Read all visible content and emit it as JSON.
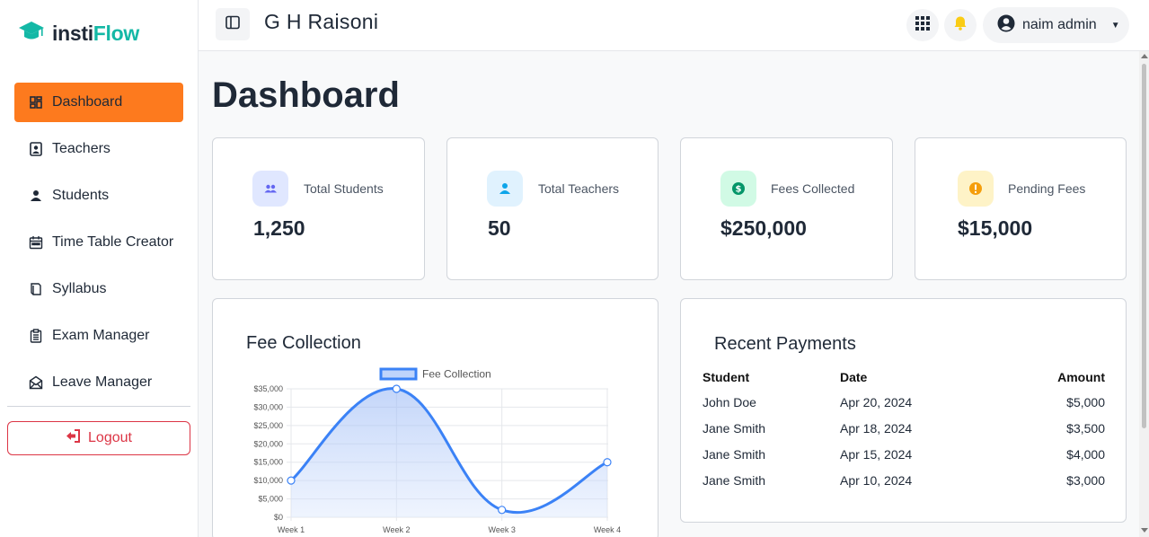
{
  "brand": {
    "part1": "insti",
    "part2": "Flow"
  },
  "sidebar": {
    "items": [
      {
        "label": "Dashboard",
        "icon": "dashboard-icon"
      },
      {
        "label": "Teachers",
        "icon": "teacher-icon"
      },
      {
        "label": "Students",
        "icon": "person-icon"
      },
      {
        "label": "Time Table Creator",
        "icon": "calendar-icon"
      },
      {
        "label": "Syllabus",
        "icon": "book-icon"
      },
      {
        "label": "Exam Manager",
        "icon": "clipboard-icon"
      },
      {
        "label": "Leave Manager",
        "icon": "envelope-icon"
      }
    ],
    "logout_label": "Logout"
  },
  "header": {
    "org_name": "G H Raisoni",
    "user_name": "naim admin"
  },
  "main": {
    "title": "Dashboard",
    "stats": [
      {
        "label": "Total Students",
        "value": "1,250",
        "icon": "people-icon",
        "color": "#6366f1",
        "bg": "#e0e7ff"
      },
      {
        "label": "Total Teachers",
        "value": "50",
        "icon": "person-icon",
        "color": "#0ea5e9",
        "bg": "#e0f2fe"
      },
      {
        "label": "Fees Collected",
        "value": "$250,000",
        "icon": "dollar-icon",
        "color": "#059669",
        "bg": "#d1fae5"
      },
      {
        "label": "Pending Fees",
        "value": "$15,000",
        "icon": "alert-icon",
        "color": "#f59e0b",
        "bg": "#fef3c7"
      }
    ],
    "fee_title": "Fee Collection",
    "payments_title": "Recent Payments",
    "payments": {
      "headers": [
        "Student",
        "Date",
        "Amount"
      ],
      "rows": [
        [
          "John Doe",
          "Apr 20, 2024",
          "$5,000"
        ],
        [
          "Jane Smith",
          "Apr 18, 2024",
          "$3,500"
        ],
        [
          "Jane Smith",
          "Apr 15, 2024",
          "$4,000"
        ],
        [
          "Jane Smith",
          "Apr 10, 2024",
          "$3,000"
        ]
      ]
    }
  },
  "colors": {
    "accent": "#fd7a1e",
    "brand_teal": "#14b8a6",
    "danger": "#dc3545",
    "line": "#3b82f6"
  },
  "chart_data": {
    "type": "line",
    "x": [
      "Week 1",
      "Week 2",
      "Week 3",
      "Week 4"
    ],
    "series": [
      {
        "name": "Fee Collection",
        "values": [
          10000,
          35000,
          2000,
          15000
        ]
      }
    ],
    "ylim": [
      0,
      35000
    ],
    "yticks": [
      "$0",
      "$5,000",
      "$10,000",
      "$15,000",
      "$20,000",
      "$25,000",
      "$30,000",
      "$35,000"
    ],
    "legend": "top",
    "grid": true
  }
}
